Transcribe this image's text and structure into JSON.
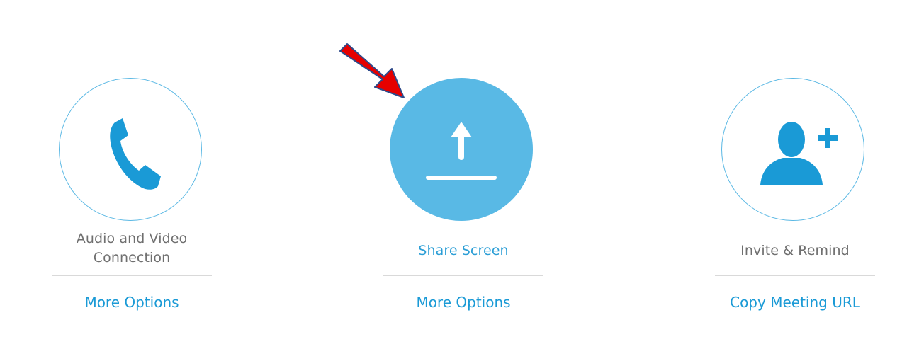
{
  "colors": {
    "accent": "#59b9e5",
    "link": "#1a9ad6",
    "icon": "#1a9ad6",
    "label_gray": "#6f6f6f",
    "pointer_arrow": "#e60000"
  },
  "actions": [
    {
      "icon": "phone-icon",
      "label_line1": "Audio and Video",
      "label_line2": "Connection",
      "link": "More Options"
    },
    {
      "icon": "upload-icon",
      "label_line1": "Share Screen",
      "link": "More Options"
    },
    {
      "icon": "add-user-icon",
      "label_line1": "Invite & Remind",
      "link": "Copy Meeting URL"
    }
  ]
}
